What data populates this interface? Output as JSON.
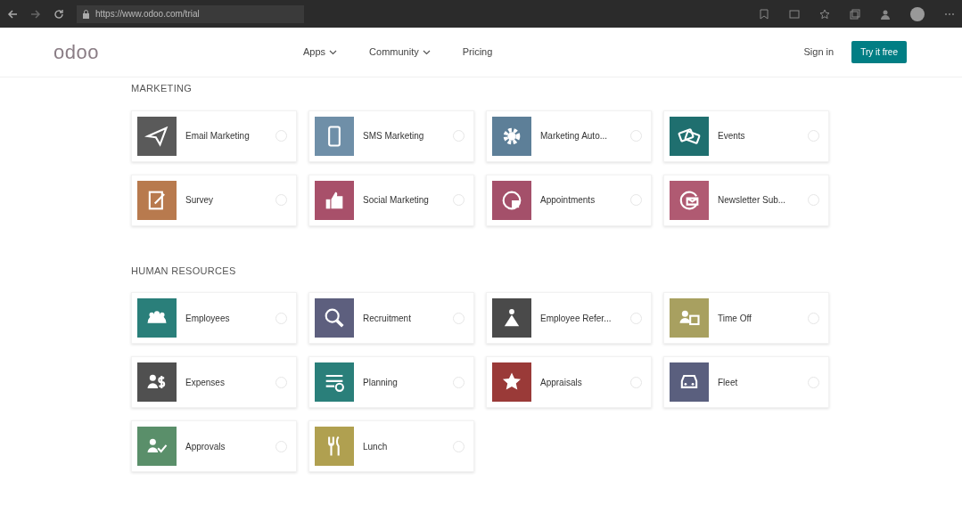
{
  "browser": {
    "url": "https://www.odoo.com/trial"
  },
  "navbar": {
    "logo": "odoo",
    "links": [
      {
        "label": "Apps",
        "dropdown": true
      },
      {
        "label": "Community",
        "dropdown": true
      },
      {
        "label": "Pricing",
        "dropdown": false
      }
    ],
    "sign_in": "Sign in",
    "cta": "Try it free"
  },
  "sections": [
    {
      "title": "MARKETING",
      "apps": [
        {
          "name": "Email Marketing",
          "color": "#5a5a5a",
          "selected": false
        },
        {
          "name": "SMS Marketing",
          "color": "#6f8fa8",
          "selected": false
        },
        {
          "name": "Marketing Auto...",
          "color": "#5d7f98",
          "selected": false
        },
        {
          "name": "Events",
          "color": "#1f6f6f",
          "selected": false
        },
        {
          "name": "Survey",
          "color": "#b87a4e",
          "selected": false
        },
        {
          "name": "Social Marketing",
          "color": "#a8506a",
          "selected": false
        },
        {
          "name": "Appointments",
          "color": "#a4506a",
          "selected": false
        },
        {
          "name": "Newsletter Sub...",
          "color": "#b05a72",
          "selected": false
        }
      ]
    },
    {
      "title": "HUMAN RESOURCES",
      "apps": [
        {
          "name": "Employees",
          "color": "#2a7f7a",
          "selected": false
        },
        {
          "name": "Recruitment",
          "color": "#5d5f7e",
          "selected": false
        },
        {
          "name": "Employee Refer...",
          "color": "#4a4a4a",
          "selected": false
        },
        {
          "name": "Time Off",
          "color": "#a8a060",
          "selected": false
        },
        {
          "name": "Expenses",
          "color": "#505050",
          "selected": false
        },
        {
          "name": "Planning",
          "color": "#2a7f7a",
          "selected": false
        },
        {
          "name": "Appraisals",
          "color": "#9a3a38",
          "selected": false
        },
        {
          "name": "Fleet",
          "color": "#5a5f7e",
          "selected": false
        },
        {
          "name": "Approvals",
          "color": "#5a8f6a",
          "selected": false
        },
        {
          "name": "Lunch",
          "color": "#b0a050",
          "selected": false
        }
      ]
    }
  ]
}
